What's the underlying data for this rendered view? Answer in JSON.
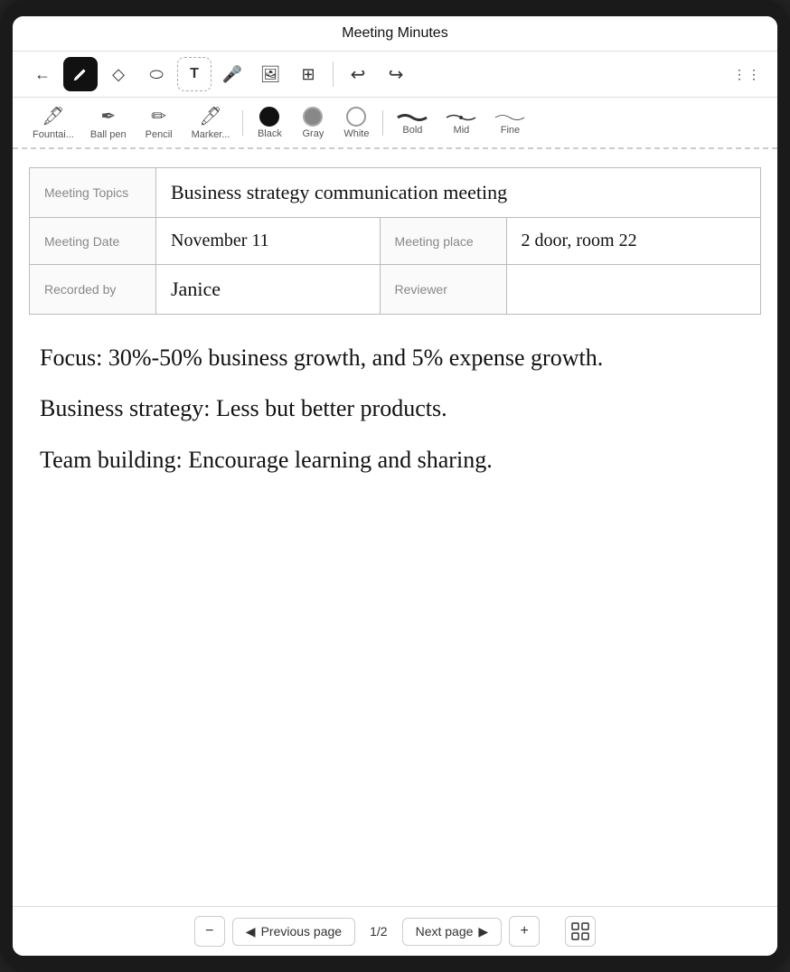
{
  "app": {
    "title": "Meeting Minutes"
  },
  "toolbar": {
    "back_label": "←",
    "tools": [
      {
        "id": "pen",
        "icon": "✏️",
        "label": "Pen",
        "active": true
      },
      {
        "id": "eraser",
        "icon": "◇",
        "label": "Eraser",
        "active": false
      },
      {
        "id": "lasso",
        "icon": "⬭",
        "label": "Lasso",
        "active": false
      },
      {
        "id": "text",
        "icon": "T",
        "label": "Text",
        "active": false
      },
      {
        "id": "mic",
        "icon": "🎤",
        "label": "Mic",
        "active": false
      },
      {
        "id": "image",
        "icon": "🖼",
        "label": "Image",
        "active": false
      },
      {
        "id": "table",
        "icon": "⊞",
        "label": "Table",
        "active": false
      },
      {
        "id": "undo",
        "icon": "↩",
        "label": "Undo",
        "active": false
      },
      {
        "id": "redo",
        "icon": "↪",
        "label": "Redo",
        "active": false
      },
      {
        "id": "more",
        "icon": "⋮⋮",
        "label": "More",
        "active": false
      }
    ]
  },
  "subtoolbar": {
    "pen_types": [
      {
        "id": "fountain",
        "label": "Fountai...",
        "icon": "𝒻"
      },
      {
        "id": "ballpen",
        "label": "Ball pen",
        "icon": "𝓫"
      },
      {
        "id": "pencil",
        "label": "Pencil",
        "icon": "𝓅"
      },
      {
        "id": "marker",
        "label": "Marker...",
        "icon": "𝓜"
      }
    ],
    "colors": [
      {
        "id": "black",
        "label": "Black",
        "color": "black",
        "selected": true
      },
      {
        "id": "gray",
        "label": "Gray",
        "color": "gray",
        "selected": false
      },
      {
        "id": "white",
        "label": "White",
        "color": "white",
        "selected": false
      }
    ],
    "strokes": [
      {
        "id": "bold",
        "label": "Bold"
      },
      {
        "id": "mid",
        "label": "Mid"
      },
      {
        "id": "fine",
        "label": "Fine"
      }
    ]
  },
  "table": {
    "rows": [
      {
        "col1_label": "Meeting Topics",
        "col1_value": "Business strategy communication meeting",
        "col2_label": "",
        "col2_value": ""
      },
      {
        "col1_label": "Meeting Date",
        "col1_value": "November 11",
        "col2_label": "Meeting place",
        "col2_value": "2 door, room 22"
      },
      {
        "col1_label": "Recorded by",
        "col1_value": "Janice",
        "col2_label": "Reviewer",
        "col2_value": ""
      }
    ]
  },
  "notes": [
    {
      "text": "Focus: 30%-50% business growth, and 5% expense growth."
    },
    {
      "text": "Business strategy: Less but better products."
    },
    {
      "text": "Team building: Encourage learning and sharing."
    }
  ],
  "pagination": {
    "prev_label": "Previous page",
    "next_label": "Next page",
    "current": "1",
    "total": "2",
    "separator": "/"
  }
}
